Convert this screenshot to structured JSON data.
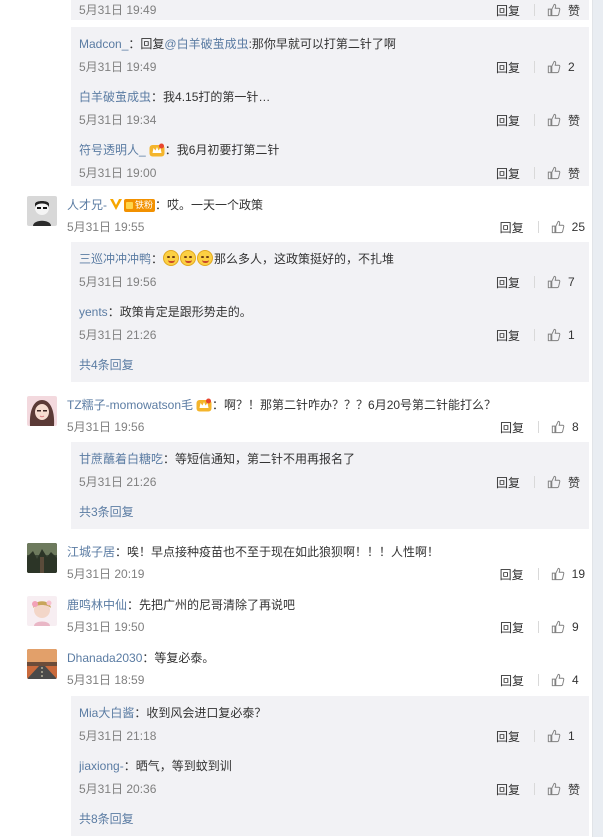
{
  "reply_label": "回复",
  "entries": [
    {
      "kind": "reply-first",
      "time": "5月31日 19:49",
      "likes": "",
      "like_label": "赞"
    },
    {
      "kind": "reply",
      "user": "Madcon_",
      "prefix": "回复",
      "mention": "@白羊破茧成虫",
      "text": ":那你早就可以打第二针了啊",
      "time": "5月31日 19:49",
      "likes": "2"
    },
    {
      "kind": "reply",
      "user": "白羊破茧成虫",
      "text": "：我4.15打的第一针…",
      "time": "5月31日 19:34",
      "likes": "",
      "like_label": "赞"
    },
    {
      "kind": "reply",
      "user": "符号透明人_",
      "crown": true,
      "text": "：我6月初要打第二针",
      "time": "5月31日 19:00",
      "likes": "",
      "like_label": "赞"
    },
    {
      "kind": "comment",
      "user": "人才兄-",
      "vbadge": true,
      "fan_badge": "铁粉",
      "avatar": "avatar-rencaixiong",
      "text": "：哎。一天一个政策",
      "time": "5月31日 19:55",
      "likes": "25"
    },
    {
      "kind": "reply",
      "user": "三巡冲冲冲鸭",
      "emojis": 3,
      "text": "那么多人，这政策挺好的，不扎堆",
      "time": "5月31日 19:56",
      "likes": "7"
    },
    {
      "kind": "reply",
      "user": "yents",
      "text": "：政策肯定是跟形势走的。",
      "time": "5月31日 21:26",
      "likes": "1"
    },
    {
      "kind": "more",
      "text": "共4条回复"
    },
    {
      "kind": "comment",
      "user": "TZ糯子-momowatson毛",
      "crown": true,
      "avatar": "avatar-tz",
      "text": "：啊？！那第二针咋办？？？6月20号第二针能打么？",
      "time": "5月31日 19:56",
      "likes": "8"
    },
    {
      "kind": "reply",
      "user": "甘蔗蘸着白糖吃",
      "text": "：等短信通知，第二针不用再报名了",
      "time": "5月31日 21:26",
      "likes": "",
      "like_label": "赞"
    },
    {
      "kind": "more",
      "text": "共3条回复"
    },
    {
      "kind": "comment",
      "user": "江城子居",
      "avatar": "avatar-jiangcheng",
      "text": "：唉！早点接种疫苗也不至于现在如此狼狈啊！！！人性啊！",
      "time": "5月31日 20:19",
      "likes": "19"
    },
    {
      "kind": "comment",
      "user": "鹿鸣林中仙",
      "avatar": "avatar-luming",
      "text": "：先把广州的尼哥清除了再说吧",
      "time": "5月31日 19:50",
      "likes": "9"
    },
    {
      "kind": "comment",
      "user": "Dhanada2030",
      "avatar": "avatar-dhanada",
      "text": "：等复必泰。",
      "time": "5月31日 18:59",
      "likes": "4"
    },
    {
      "kind": "reply",
      "user": "Mia大白酱",
      "text": "：收到风会进口复必泰？",
      "time": "5月31日 21:18",
      "likes": "1"
    },
    {
      "kind": "reply",
      "user": "jiaxiong-",
      "text": "：晒气，等到蚊到训",
      "time": "5月31日 20:36",
      "likes": "",
      "like_label": "赞"
    },
    {
      "kind": "more",
      "text": "共8条回复"
    }
  ]
}
